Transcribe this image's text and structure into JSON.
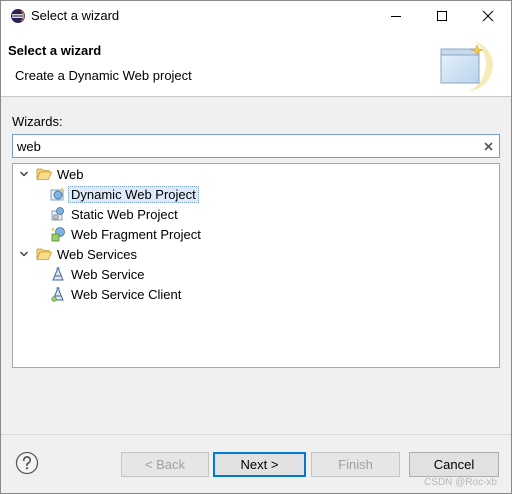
{
  "window": {
    "title": "Select a wizard",
    "icon": "eclipse-icon"
  },
  "banner": {
    "title": "Select a wizard",
    "description": "Create a Dynamic Web project"
  },
  "filter": {
    "label": "Wizards:",
    "value": "web"
  },
  "tree": {
    "items": [
      {
        "label": "Web",
        "level": 0,
        "expanded": true,
        "icon": "folder-icon"
      },
      {
        "label": "Dynamic Web Project",
        "level": 1,
        "selected": true,
        "icon": "dynamic-web-project-icon"
      },
      {
        "label": "Static Web Project",
        "level": 1,
        "icon": "static-web-project-icon"
      },
      {
        "label": "Web Fragment Project",
        "level": 1,
        "icon": "web-fragment-project-icon"
      },
      {
        "label": "Web Services",
        "level": 0,
        "expanded": true,
        "icon": "folder-icon"
      },
      {
        "label": "Web Service",
        "level": 1,
        "icon": "web-service-icon"
      },
      {
        "label": "Web Service Client",
        "level": 1,
        "icon": "web-service-client-icon"
      }
    ]
  },
  "buttons": {
    "back": "< Back",
    "next": "Next >",
    "finish": "Finish",
    "cancel": "Cancel"
  },
  "watermark": "CSDN @Roc-xb",
  "colors": {
    "selection_bg": "#dcebfc",
    "default_button_border": "#0078d7",
    "folder": "#e8b64c"
  }
}
